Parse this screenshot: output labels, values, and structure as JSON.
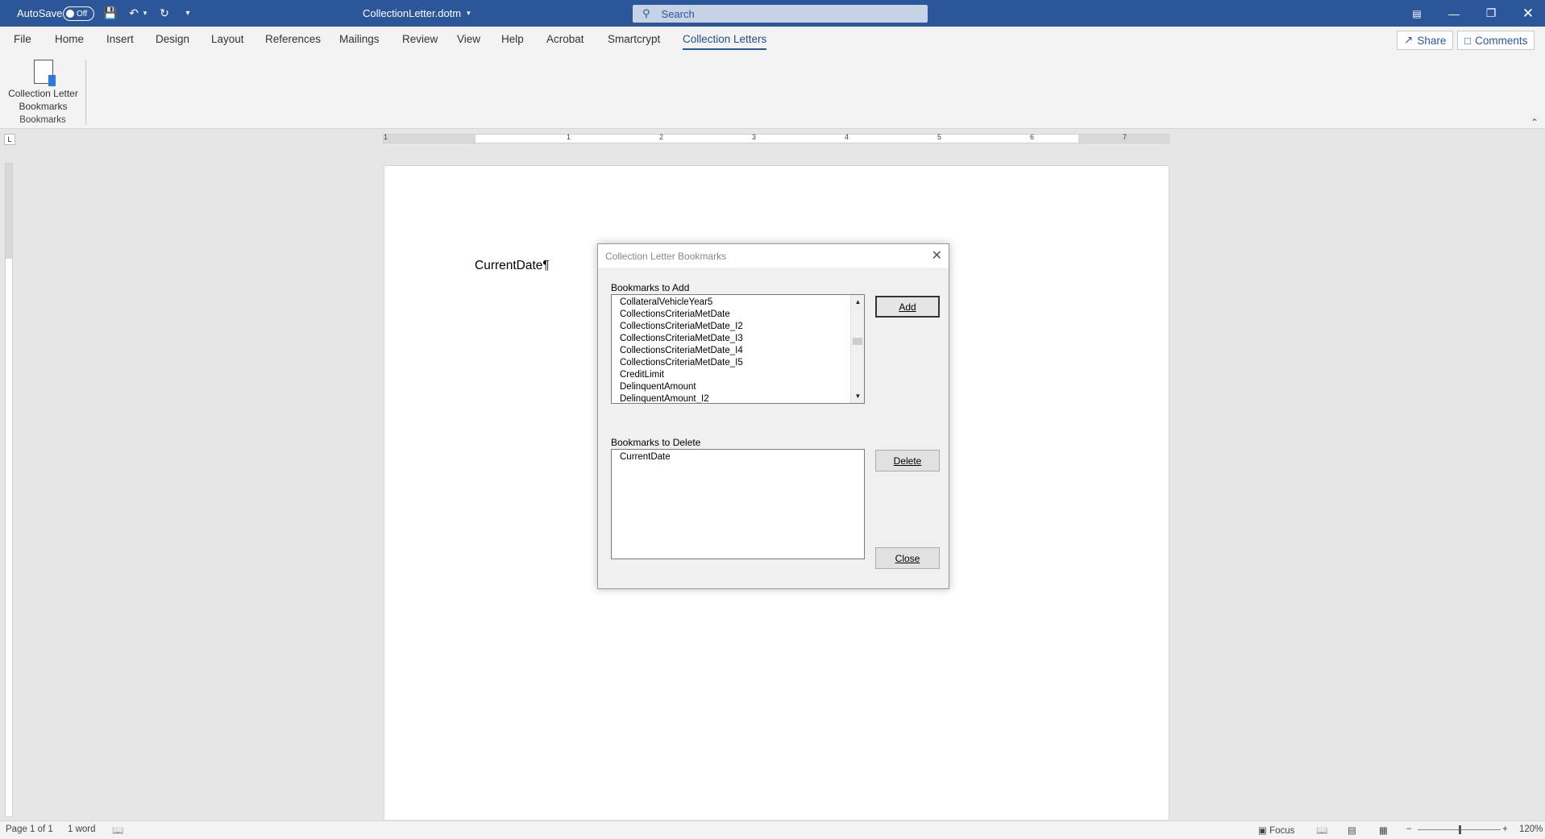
{
  "titlebar": {
    "autosave_label": "AutoSave",
    "autosave_state": "Off",
    "doc_title": "CollectionLetter.dotm",
    "search_placeholder": "Search",
    "bg_color": "#2b579a"
  },
  "menu": {
    "tabs": [
      "File",
      "Home",
      "Insert",
      "Design",
      "Layout",
      "References",
      "Mailings",
      "Review",
      "View",
      "Help",
      "Acrobat",
      "Smartcrypt",
      "Collection Letters"
    ],
    "active_tab": "Collection Letters",
    "share_label": "Share",
    "comments_label": "Comments"
  },
  "ribbon": {
    "button_label_line1": "Collection Letter",
    "button_label_line2": "Bookmarks",
    "group_label": "Bookmarks"
  },
  "ruler": {
    "numbers": [
      "1",
      "1",
      "2",
      "3",
      "4",
      "5",
      "6",
      "7"
    ]
  },
  "document": {
    "text": "CurrentDate¶"
  },
  "dialog": {
    "title": "Collection Letter Bookmarks",
    "add_section_label": "Bookmarks to Add",
    "add_items": [
      "CollateralVehicleYear5",
      "CollectionsCriteriaMetDate",
      "CollectionsCriteriaMetDate_I2",
      "CollectionsCriteriaMetDate_I3",
      "CollectionsCriteriaMetDate_I4",
      "CollectionsCriteriaMetDate_I5",
      "CreditLimit",
      "DelinquentAmount",
      "DelinquentAmount_I2"
    ],
    "delete_section_label": "Bookmarks to Delete",
    "delete_items": [
      "CurrentDate"
    ],
    "add_button": "Add",
    "delete_button": "Delete",
    "close_button": "Close"
  },
  "statusbar": {
    "page": "Page 1 of 1",
    "words": "1 word",
    "focus": "Focus",
    "zoom": "120%"
  }
}
